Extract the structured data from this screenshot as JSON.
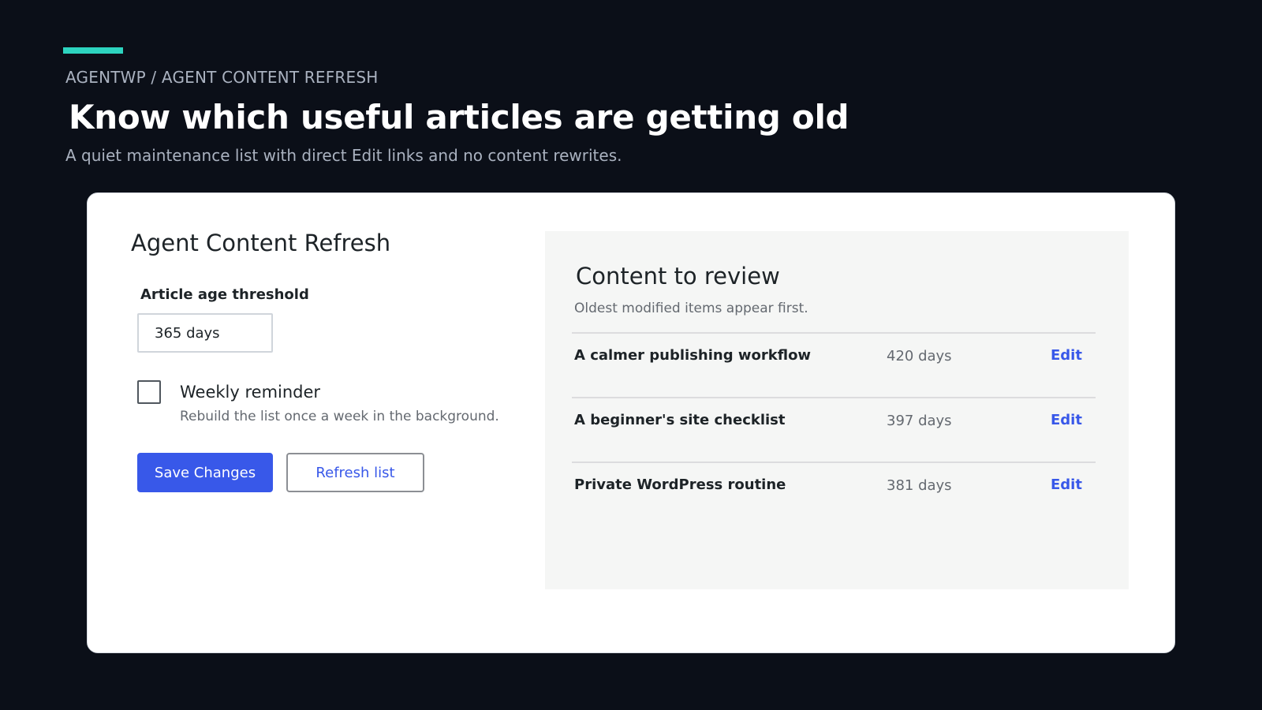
{
  "header": {
    "breadcrumb": "AGENTWP / AGENT CONTENT REFRESH",
    "title": "Know which useful articles are getting old",
    "subtitle": "A quiet maintenance list with direct Edit links and no content rewrites."
  },
  "settings": {
    "title": "Agent Content Refresh",
    "threshold_label": "Article age threshold",
    "threshold_value": "365 days",
    "reminder_label": "Weekly reminder",
    "reminder_help": "Rebuild the list once a week in the background.",
    "reminder_checked": false,
    "save_label": "Save Changes",
    "refresh_label": "Refresh list"
  },
  "review": {
    "title": "Content to review",
    "subtitle": "Oldest modified items appear first.",
    "items": [
      {
        "title": "A calmer publishing workflow",
        "age": "420 days",
        "action": "Edit"
      },
      {
        "title": "A beginner's site checklist",
        "age": "397 days",
        "action": "Edit"
      },
      {
        "title": "Private WordPress routine",
        "age": "381 days",
        "action": "Edit"
      }
    ]
  },
  "colors": {
    "background": "#0b0f18",
    "accent": "#2dd4bf",
    "primary": "#3858e9"
  }
}
